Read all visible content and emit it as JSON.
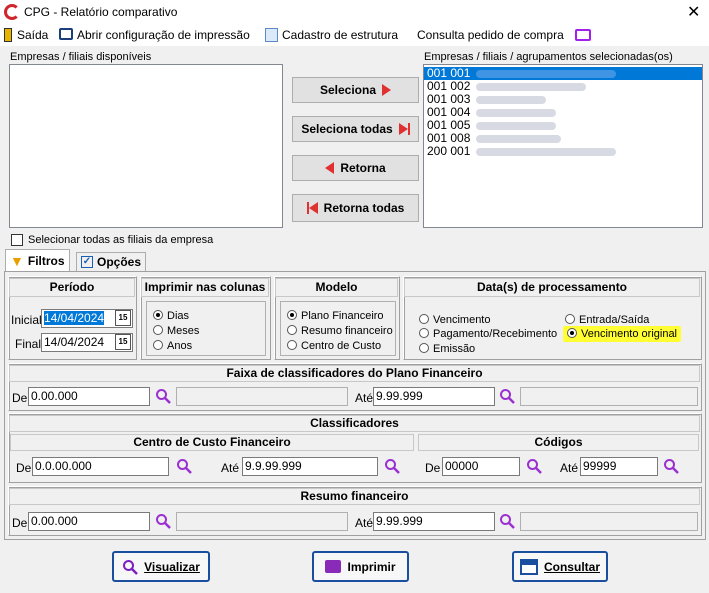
{
  "window": {
    "title": "CPG - Relatório comparativo"
  },
  "toolbar": {
    "saida": "Saída",
    "config_impressao": "Abrir configuração de impressão",
    "cadastro_estrutura": "Cadastro de estrutura",
    "consulta_pedido": "Consulta pedido de compra"
  },
  "left_list": {
    "label": "Empresas / filiais disponíveis"
  },
  "right_list": {
    "label": "Empresas / filiais / agrupamentos selecionadas(os)",
    "items": [
      "001 001",
      "001 002",
      "001 003",
      "001 004",
      "001 005",
      "001 008",
      "200 001"
    ]
  },
  "buttons": {
    "seleciona": "Seleciona",
    "seleciona_todas": "Seleciona todas",
    "retorna": "Retorna",
    "retorna_todas": "Retorna todas"
  },
  "checkbox_all": "Selecionar todas as filiais da empresa",
  "tabs": {
    "filtros": "Filtros",
    "opcoes": "Opções"
  },
  "periodo": {
    "title": "Período",
    "inicial_label": "Inicial",
    "inicial": "14/04/2024",
    "final_label": "Final",
    "final": "14/04/2024",
    "cal_icon": "15"
  },
  "imprimir": {
    "title": "Imprimir nas colunas",
    "options": [
      "Dias",
      "Meses",
      "Anos"
    ],
    "selected": "Dias"
  },
  "modelo": {
    "title": "Modelo",
    "options": [
      "Plano Financeiro",
      "Resumo financeiro",
      "Centro de Custo"
    ],
    "selected": "Plano Financeiro"
  },
  "datas": {
    "title": "Data(s) de processamento",
    "vencimento": "Vencimento",
    "pagamento": "Pagamento/Recebimento",
    "emissao": "Emissão",
    "entrada": "Entrada/Saída",
    "venc_original": "Vencimento original",
    "selected": "Vencimento original"
  },
  "faixa": {
    "title": "Faixa de classificadores do Plano Financeiro",
    "de_label": "De",
    "de": "0.00.000",
    "ate_label": "Até",
    "ate": "9.99.999"
  },
  "classificadores": {
    "title": "Classificadores",
    "centro": {
      "title": "Centro de Custo Financeiro",
      "de_label": "De",
      "de": "0.0.00.000",
      "ate_label": "Até",
      "ate": "9.9.99.999"
    },
    "codigos": {
      "title": "Códigos",
      "de_label": "De",
      "de": "00000",
      "ate_label": "Até",
      "ate": "99999"
    }
  },
  "resumo": {
    "title": "Resumo financeiro",
    "de_label": "De",
    "de": "0.00.000",
    "ate_label": "Até",
    "ate": "9.99.999"
  },
  "actions": {
    "visualizar": "Visualizar",
    "imprimir": "Imprimir",
    "consultar": "Consultar"
  },
  "colors": {
    "accent": "#0078d7",
    "danger": "#e03030",
    "highlight": "#ffff33",
    "brand": "#d0252b",
    "button_border": "#1a4fa0"
  }
}
